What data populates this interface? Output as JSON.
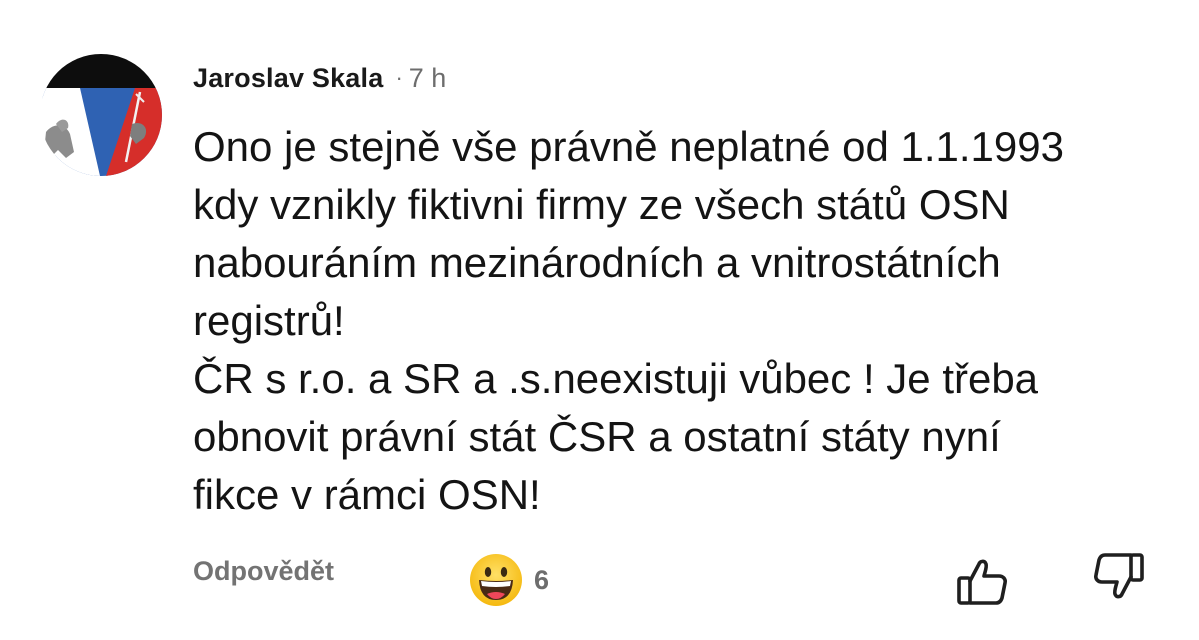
{
  "comment": {
    "author": "Jaroslav Skala",
    "separator": "·",
    "time": "7 h",
    "text_lines": [
      "Ono je stejně vše právně neplatné od 1.1.1993",
      "kdy vznikly fiktivni firmy ze všech států OSN",
      "nabouráním mezinárodních a vnitrostátních",
      "registrů!",
      "ČR s r.o. a SR a .s.neexistuji vůbec ! Je třeba",
      "obnovit právní stát ČSR a ostatní státy nyní",
      "fikce v rámci OSN!"
    ],
    "reply_label": "Odpovědět",
    "reaction_icon": "grinning-face-emoji",
    "reaction_count": "6",
    "like_icon": "thumbs-up-icon",
    "dislike_icon": "thumbs-down-icon"
  },
  "colors": {
    "author_text": "#1a1a1a",
    "meta_text": "#6d6d6d",
    "avatar_black": "#0d0d0d",
    "avatar_blue": "#2f62b3",
    "avatar_red": "#d62e2a",
    "emoji_yellow": "#f7c21f"
  }
}
